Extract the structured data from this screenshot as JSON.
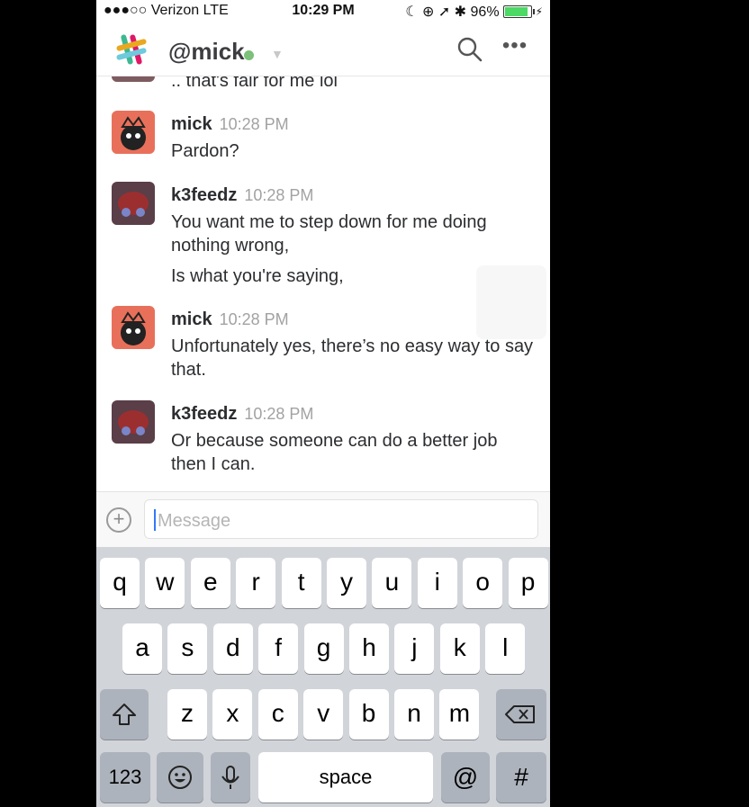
{
  "status_bar": {
    "carrier": "●●●○○ Verizon  LTE",
    "time": "10:29 PM",
    "indicators": "☾ ⊕ ➚ ✱ 96%"
  },
  "header": {
    "title": "@mick",
    "presence_color": "#7cc07a",
    "more_label": "•••"
  },
  "messages": {
    "partial_text": ".. that's fair for me lol",
    "items": [
      {
        "author": "mick",
        "time": "10:28 PM",
        "lines": [
          "Pardon?"
        ]
      },
      {
        "author": "k3feedz",
        "time": "10:28 PM",
        "lines": [
          "You want me to step down for me doing nothing wrong,",
          "Is what you're saying,"
        ]
      },
      {
        "author": "mick",
        "time": "10:28 PM",
        "lines": [
          "Unfortunately yes, there’s no easy way to say that."
        ]
      },
      {
        "author": "k3feedz",
        "time": "10:28 PM",
        "lines": [
          "Or because someone can do a better job then I can."
        ]
      }
    ]
  },
  "composer": {
    "placeholder": "Message",
    "add_label": "+"
  },
  "keyboard": {
    "row1": [
      "q",
      "w",
      "e",
      "r",
      "t",
      "y",
      "u",
      "i",
      "o",
      "p"
    ],
    "row2": [
      "a",
      "s",
      "d",
      "f",
      "g",
      "h",
      "j",
      "k",
      "l"
    ],
    "row3": [
      "z",
      "x",
      "c",
      "v",
      "b",
      "n",
      "m"
    ],
    "numbers_label": "123",
    "space_label": "space",
    "at_label": "@",
    "hash_label": "#"
  },
  "colors": {
    "accent_blue": "#3478f6",
    "battery_green": "#4cd964",
    "key_dark": "#adb3bc"
  },
  "icons": [
    "slack-logo",
    "search-icon",
    "more-icon",
    "add-icon",
    "shift-icon",
    "backspace-icon",
    "emoji-icon",
    "mic-icon",
    "battery-icon",
    "chevron-down-icon"
  ]
}
